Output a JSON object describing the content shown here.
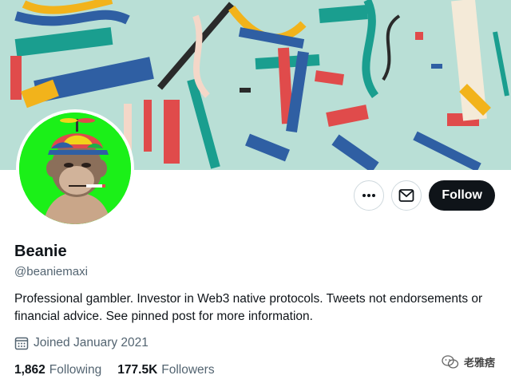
{
  "profile": {
    "name": "Beanie",
    "handle": "@beaniemaxi",
    "bio": "Professional gambler. Investor in Web3 native protocols. Tweets not endorsements or financial advice. See pinned post for more information.",
    "joined": "Joined January 2021"
  },
  "actions": {
    "more_icon": "more-icon",
    "message_icon": "mail-icon",
    "follow_label": "Follow"
  },
  "stats": {
    "following_count": "1,862",
    "following_label": "Following",
    "followers_count": "177.5K",
    "followers_label": "Followers"
  },
  "watermark": {
    "text": "老雅痞"
  },
  "colors": {
    "avatar_bg": "#1bf018",
    "follow_bg": "#0f1419",
    "secondary_text": "#536471",
    "banner_bg": "#b9dfd6"
  }
}
